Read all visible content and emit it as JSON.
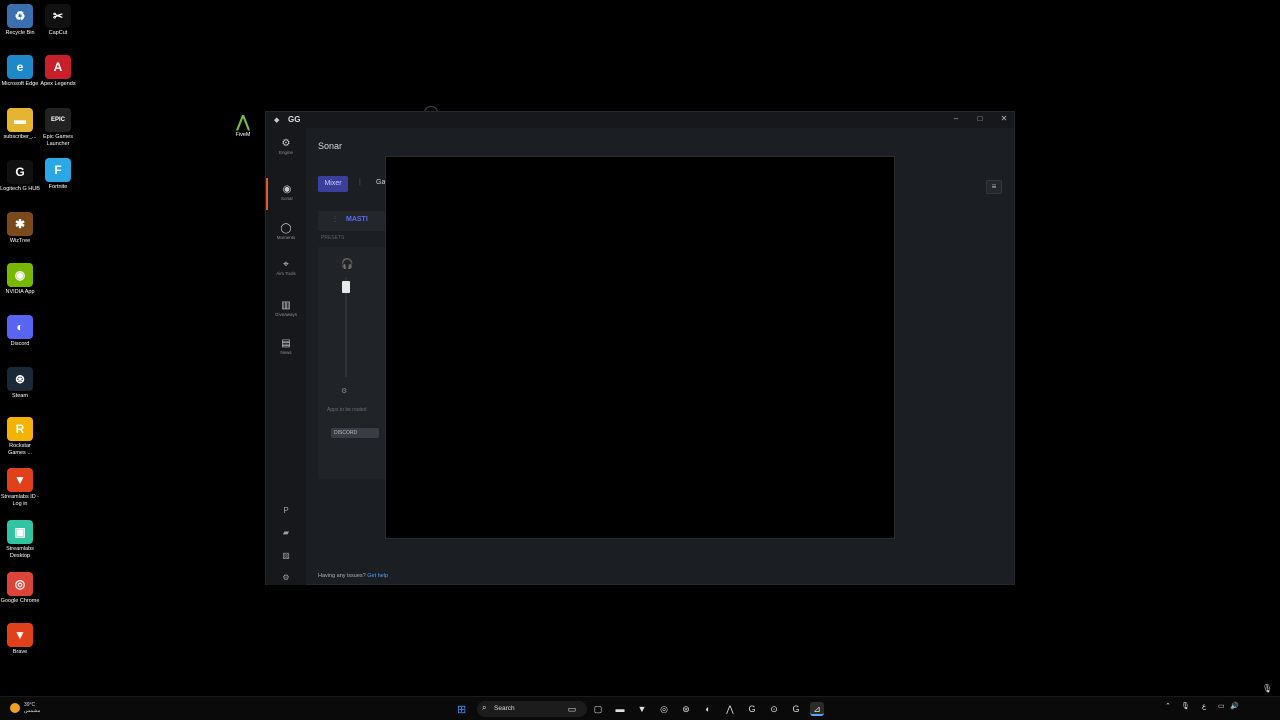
{
  "desktop_icons": [
    {
      "label": "Recycle Bin",
      "icon": "recycle-bin-icon",
      "color": "#3a6fb0",
      "glyph": "♻"
    },
    {
      "label": "CapCut",
      "icon": "capcut-icon",
      "color": "#111111",
      "glyph": "✂"
    },
    {
      "label": "Microsoft Edge",
      "icon": "edge-icon",
      "color": "#1e88c8",
      "glyph": "e"
    },
    {
      "label": "Apex Legends",
      "icon": "apex-icon",
      "color": "#c8202a",
      "glyph": "A"
    },
    {
      "label": "subscriber_...",
      "icon": "folder-icon",
      "color": "#e6b530",
      "glyph": "▬"
    },
    {
      "label": "Epic Games Launcher",
      "icon": "epic-games-icon",
      "color": "#222222",
      "glyph": "EPIC"
    },
    {
      "label": "Logitech G HUB",
      "icon": "logitech-icon",
      "color": "#111111",
      "glyph": "G"
    },
    {
      "label": "Fortnite",
      "icon": "fortnite-icon",
      "color": "#2aa8e6",
      "glyph": "F"
    },
    {
      "label": "WizTree",
      "icon": "wiztree-icon",
      "color": "#7a4a1a",
      "glyph": "✱"
    },
    {
      "label": "NVIDIA App",
      "icon": "nvidia-icon",
      "color": "#76b900",
      "glyph": "◉"
    },
    {
      "label": "Discord",
      "icon": "discord-icon",
      "color": "#5865f2",
      "glyph": "◐"
    },
    {
      "label": "Steam",
      "icon": "steam-icon",
      "color": "#1b2838",
      "glyph": "⊛"
    },
    {
      "label": "Rockstar Games ...",
      "icon": "rockstar-icon",
      "color": "#f5b200",
      "glyph": "R"
    },
    {
      "label": "Streamlabs ID - Log in",
      "icon": "brave-icon",
      "color": "#e0411b",
      "glyph": "▼"
    },
    {
      "label": "Streamlabs Desktop",
      "icon": "streamlabs-icon",
      "color": "#31c3a2",
      "glyph": "▣"
    },
    {
      "label": "Google Chrome",
      "icon": "chrome-icon",
      "color": "#db4437",
      "glyph": "◎"
    },
    {
      "label": "Brave",
      "icon": "brave-icon",
      "color": "#e0411b",
      "glyph": "▼"
    }
  ],
  "fivem": {
    "label": "FiveM"
  },
  "window": {
    "title": "GG",
    "minimize": "–",
    "maximize": "□",
    "close": "✕"
  },
  "sidebar": {
    "items": [
      {
        "label": "Engine",
        "icon": "engine-gear-icon",
        "glyph": "⚙"
      },
      {
        "label": "Sonar",
        "icon": "sonar-icon",
        "glyph": "◉"
      },
      {
        "label": "Moments",
        "icon": "moments-icon",
        "glyph": "◯"
      },
      {
        "label": "Aim Tools",
        "icon": "aim-tools-icon",
        "glyph": "⌖"
      },
      {
        "label": "Giveaways",
        "icon": "giveaways-gift-icon",
        "glyph": "▥"
      },
      {
        "label": "News",
        "icon": "news-icon",
        "glyph": "▤"
      }
    ],
    "bottom": [
      {
        "icon": "profile-avatar-icon",
        "glyph": "P"
      },
      {
        "icon": "notifications-icon",
        "glyph": "▰"
      },
      {
        "icon": "gallery-icon",
        "glyph": "▨"
      },
      {
        "icon": "settings-gear-icon",
        "glyph": "⚙"
      }
    ]
  },
  "main": {
    "title": "Sonar",
    "tabs": [
      {
        "label": "Mixer"
      },
      {
        "label": "Ga"
      }
    ],
    "tab_separator": "|",
    "menu_glyph": "≡",
    "master_label": "MASTI",
    "master_glyph": "⫶",
    "presets_label": "PRESETS",
    "headphone_glyph": "🎧",
    "settings_small_glyph": "⚙",
    "apps_routed": "Apps to be routed",
    "discord_chip": "DISCORD",
    "help_text": "Having any issues?",
    "help_link": "Get help"
  },
  "taskbar": {
    "weather_temp": "39°C",
    "weather_desc": "مشمس",
    "search_placeholder": "Search",
    "search_glyph": "⌕",
    "start_glyph": "⊞",
    "apps": [
      {
        "icon": "widget-icon",
        "glyph": "▭"
      },
      {
        "icon": "task-view-icon",
        "glyph": "▢"
      },
      {
        "icon": "file-explorer-icon",
        "glyph": "▬"
      },
      {
        "icon": "brave-taskbar-icon",
        "glyph": "▼"
      },
      {
        "icon": "chrome-taskbar-icon",
        "glyph": "◎"
      },
      {
        "icon": "steam-taskbar-icon",
        "glyph": "⊛"
      },
      {
        "icon": "discord-taskbar-icon",
        "glyph": "◐"
      },
      {
        "icon": "fivem-taskbar-icon",
        "glyph": "⋀"
      },
      {
        "icon": "logitech-taskbar-icon",
        "glyph": "G"
      },
      {
        "icon": "steelseries-taskbar-icon",
        "glyph": "⊙"
      },
      {
        "icon": "logitech-g-taskbar-icon",
        "glyph": "G"
      },
      {
        "icon": "steelseries-gg-taskbar-icon",
        "glyph": "⊿"
      }
    ],
    "tray_chevron": "⌃",
    "tray_mic": "🎙",
    "tray_lang": "ع",
    "tray_network": "▭",
    "tray_volume": "🔊",
    "tray_battery": "⚡",
    "clock": "",
    "date": ""
  }
}
